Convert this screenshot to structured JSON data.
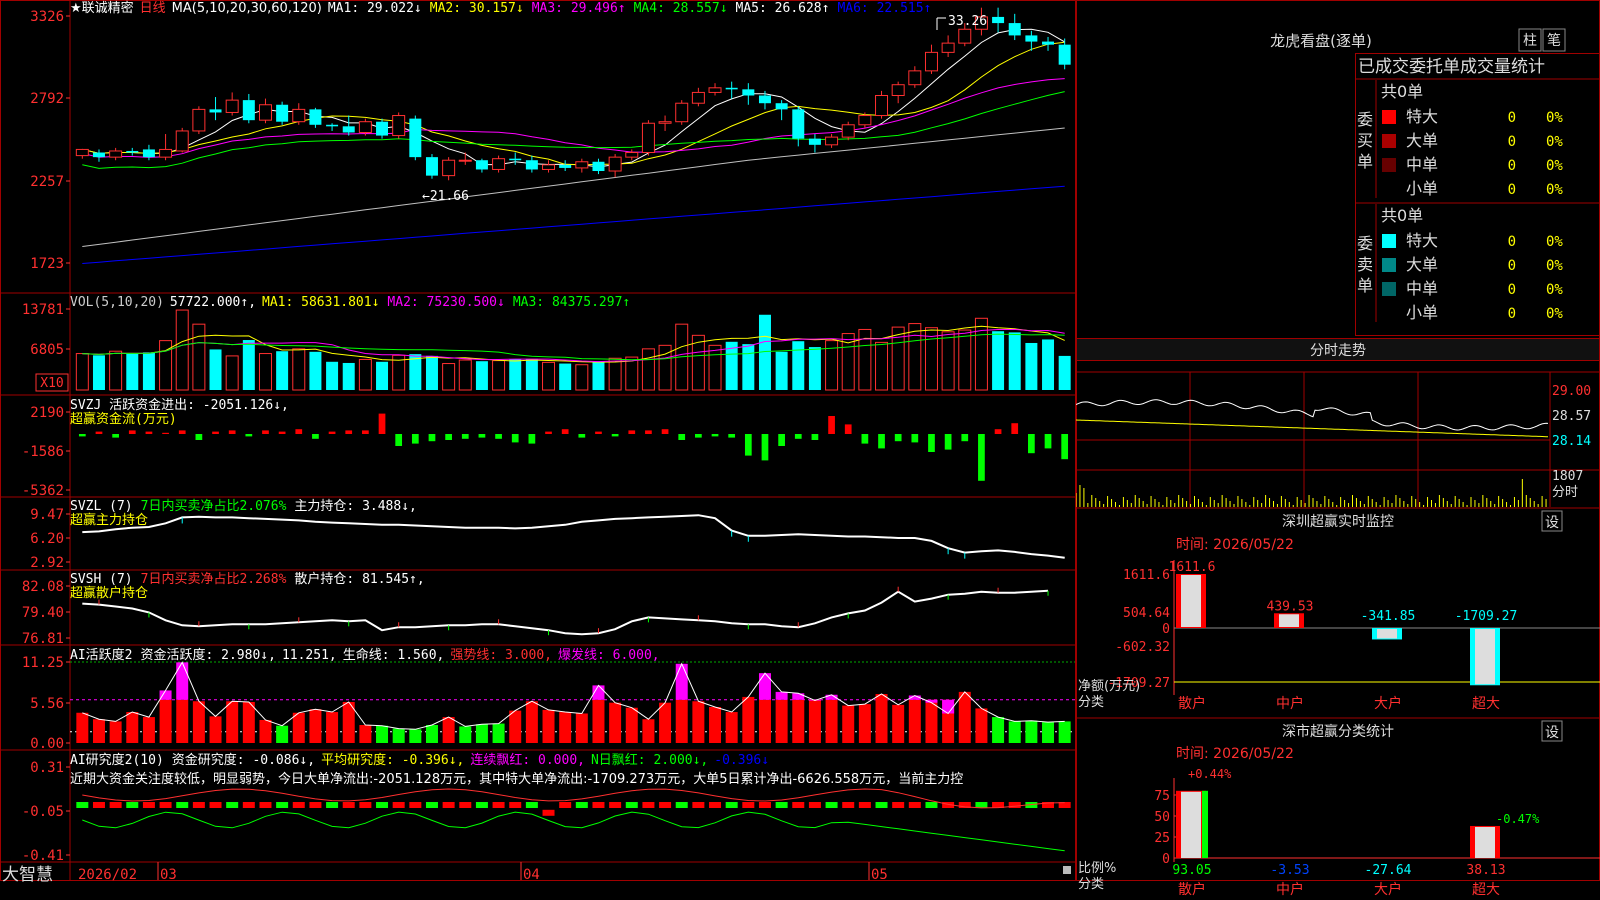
{
  "chart_data": [
    {
      "type": "candlestick",
      "panel": "price",
      "title": "★联诚精密",
      "period": "日线",
      "ma_title": "MA(5,10,20,30,60,120)",
      "ma": [
        {
          "name": "MA1",
          "value": "29.022",
          "arrow": "↓",
          "color": "#ffffff"
        },
        {
          "name": "MA2",
          "value": "30.157",
          "arrow": "↓",
          "color": "#ffff00"
        },
        {
          "name": "MA3",
          "value": "29.496",
          "arrow": "↑",
          "color": "#ff00ff"
        },
        {
          "name": "MA4",
          "value": "28.557",
          "arrow": "↓",
          "color": "#00ff00"
        },
        {
          "name": "MA5",
          "value": "26.628",
          "arrow": "↑",
          "color": "#c0c0c0"
        },
        {
          "name": "MA6",
          "value": "22.515",
          "arrow": "↑",
          "color": "#0000ff"
        }
      ],
      "y_ticks": [
        "3326",
        "2792",
        "2257",
        "1723"
      ],
      "annotations": [
        {
          "text": "33.26"
        },
        {
          "text": "←21.66"
        }
      ],
      "candles": [
        [
          24.2,
          24.6,
          24.0,
          24.4
        ],
        [
          24.4,
          24.1,
          23.8,
          24.6
        ],
        [
          24.1,
          24.5,
          23.9,
          24.7
        ],
        [
          24.5,
          24.4,
          24.2,
          24.7
        ],
        [
          24.6,
          24.1,
          23.9,
          24.9
        ],
        [
          24.1,
          24.6,
          23.9,
          25.6
        ],
        [
          24.5,
          25.8,
          24.4,
          26.0
        ],
        [
          25.8,
          27.2,
          25.6,
          27.4
        ],
        [
          27.2,
          27.0,
          26.5,
          28.0
        ],
        [
          27.0,
          27.8,
          26.8,
          28.3
        ],
        [
          27.8,
          26.5,
          26.3,
          28.2
        ],
        [
          26.5,
          27.5,
          26.3,
          27.9
        ],
        [
          27.5,
          26.4,
          26.2,
          27.7
        ],
        [
          26.4,
          27.2,
          26.2,
          27.6
        ],
        [
          27.2,
          26.2,
          26.0,
          27.3
        ],
        [
          26.2,
          26.1,
          25.8,
          26.3
        ],
        [
          26.1,
          25.7,
          25.5,
          26.8
        ],
        [
          25.7,
          26.4,
          25.5,
          26.6
        ],
        [
          26.4,
          25.5,
          25.3,
          26.6
        ],
        [
          25.5,
          26.8,
          25.3,
          27.0
        ],
        [
          26.6,
          24.1,
          23.9,
          26.8
        ],
        [
          24.1,
          22.9,
          22.7,
          24.3
        ],
        [
          22.9,
          23.9,
          22.6,
          24.1
        ],
        [
          23.9,
          23.9,
          23.6,
          24.4
        ],
        [
          23.9,
          23.3,
          23.1,
          24.0
        ],
        [
          23.3,
          24.0,
          23.1,
          24.2
        ],
        [
          24.0,
          23.9,
          23.6,
          24.4
        ],
        [
          23.9,
          23.3,
          23.1,
          24.2
        ],
        [
          23.3,
          23.6,
          23.1,
          23.9
        ],
        [
          23.6,
          23.4,
          23.2,
          23.9
        ],
        [
          23.4,
          23.8,
          23.1,
          24.0
        ],
        [
          23.8,
          23.2,
          23.0,
          24.0
        ],
        [
          23.2,
          24.1,
          22.8,
          24.3
        ],
        [
          24.1,
          24.4,
          23.9,
          24.6
        ],
        [
          24.4,
          26.3,
          24.2,
          26.5
        ],
        [
          26.3,
          26.4,
          25.8,
          26.8
        ],
        [
          26.4,
          27.6,
          26.2,
          27.8
        ],
        [
          27.6,
          28.3,
          27.4,
          28.6
        ],
        [
          28.3,
          28.6,
          28.1,
          28.9
        ],
        [
          28.6,
          28.5,
          27.9,
          29.0
        ],
        [
          28.5,
          28.1,
          27.5,
          28.9
        ],
        [
          28.1,
          27.6,
          27.2,
          28.4
        ],
        [
          27.6,
          27.2,
          26.5,
          27.8
        ],
        [
          27.2,
          25.3,
          24.8,
          27.4
        ],
        [
          25.3,
          24.9,
          24.4,
          25.6
        ],
        [
          24.9,
          25.4,
          24.7,
          25.6
        ],
        [
          25.4,
          26.2,
          25.2,
          26.4
        ],
        [
          26.2,
          26.8,
          26.0,
          27.0
        ],
        [
          26.8,
          28.1,
          26.6,
          28.4
        ],
        [
          28.1,
          28.8,
          27.6,
          29.0
        ],
        [
          28.8,
          29.7,
          28.6,
          30.0
        ],
        [
          29.7,
          30.9,
          29.5,
          31.4
        ],
        [
          30.9,
          31.5,
          30.6,
          32.0
        ],
        [
          31.5,
          32.4,
          31.3,
          32.8
        ],
        [
          32.4,
          33.2,
          32.0,
          33.8
        ],
        [
          33.2,
          32.8,
          32.2,
          33.8
        ],
        [
          32.8,
          32.0,
          31.7,
          33.4
        ],
        [
          32.0,
          31.6,
          31.0,
          32.3
        ],
        [
          31.6,
          31.4,
          31.0,
          31.9
        ],
        [
          31.4,
          30.1,
          29.8,
          31.8
        ]
      ]
    },
    {
      "type": "bar",
      "panel": "volume",
      "title": "VOL(5,10,20)",
      "value": "57722.000",
      "ma": [
        {
          "name": "MA1",
          "value": "58631.801",
          "arrow": "↓",
          "color": "#ffff00"
        },
        {
          "name": "MA2",
          "value": "75230.500",
          "arrow": "↓",
          "color": "#ff00ff"
        },
        {
          "name": "MA3",
          "value": "84375.297",
          "arrow": "↑",
          "color": "#00ff00"
        }
      ],
      "y_ticks": [
        "13781",
        "6805"
      ],
      "unit": "X10",
      "values": [
        6.2,
        5.9,
        6.6,
        6.2,
        6.4,
        8.4,
        13.6,
        11.2,
        6.9,
        5.8,
        8.5,
        6.2,
        6.6,
        7.0,
        6.5,
        4.8,
        4.6,
        5.2,
        4.8,
        5.9,
        6.1,
        5.8,
        4.5,
        5.1,
        4.9,
        5.0,
        5.2,
        5.3,
        4.7,
        4.5,
        4.3,
        4.9,
        5.4,
        5.6,
        7.0,
        7.6,
        11.2,
        9.3,
        7.6,
        8.2,
        7.8,
        12.8,
        6.5,
        8.3,
        7.3,
        8.4,
        9.6,
        10.3,
        8.1,
        10.7,
        11.3,
        10.6,
        9.9,
        10.2,
        12.2,
        10.0,
        9.8,
        8.0,
        8.6,
        5.8
      ]
    },
    {
      "type": "bar",
      "panel": "svzj",
      "title": "SVZJ",
      "label": "活跃资金进出:",
      "value": "-2051.126",
      "arrow": "↓,",
      "subtitle": "超赢资金流(万元)",
      "y_ticks": [
        "2190",
        "-1586",
        "-5362"
      ],
      "values": [
        -0.2,
        0.2,
        -0.3,
        0.3,
        0.2,
        0.1,
        0.3,
        -0.5,
        0.2,
        0.3,
        -0.2,
        0.3,
        0.2,
        0.4,
        -0.4,
        0.2,
        0.3,
        0.3,
        1.7,
        -1.0,
        -0.8,
        -0.6,
        -0.5,
        -0.4,
        -0.3,
        -0.4,
        -0.7,
        -0.8,
        0.2,
        0.4,
        -0.3,
        0.2,
        -0.2,
        0.3,
        0.3,
        0.4,
        -0.5,
        -0.3,
        -0.2,
        -0.3,
        -1.8,
        -2.2,
        -1.0,
        -0.4,
        -0.5,
        1.5,
        0.8,
        -0.8,
        -1.2,
        -0.6,
        -0.7,
        -1.5,
        -1.3,
        -0.6,
        -3.9,
        0.4,
        0.9,
        -1.6,
        -1.2,
        -2.1
      ]
    },
    {
      "type": "line",
      "panel": "svzl",
      "title": "SVZL (7)",
      "label": "7日内买卖净占比2.076%",
      "main_label": "主力持仓:",
      "value": "3.488",
      "arrow": "↓,",
      "subtitle": "超赢主力持仓",
      "y_ticks": [
        "9.47",
        "6.20",
        "2.92"
      ],
      "values": [
        7.0,
        7.1,
        7.4,
        7.6,
        7.7,
        8.2,
        9.0,
        9.1,
        9.0,
        9.0,
        8.9,
        8.8,
        8.7,
        8.6,
        8.4,
        8.3,
        8.2,
        8.1,
        8.0,
        8.0,
        7.9,
        7.8,
        7.7,
        7.6,
        7.6,
        7.6,
        7.5,
        7.6,
        7.8,
        8.0,
        8.4,
        8.6,
        8.8,
        8.9,
        9.0,
        9.1,
        9.2,
        9.3,
        8.9,
        7.2,
        6.5,
        6.5,
        6.6,
        6.7,
        6.6,
        6.5,
        6.4,
        6.4,
        6.3,
        6.2,
        6.2,
        5.8,
        4.8,
        4.2,
        4.4,
        4.5,
        4.3,
        4.0,
        3.8,
        3.5
      ]
    },
    {
      "type": "line",
      "panel": "svsh",
      "title": "SVSH (7)",
      "label": "7日内买卖净占比2.268%",
      "main_label": "散户持仓:",
      "value": "81.545",
      "arrow": "↑,",
      "subtitle": "超赢散户持仓",
      "y_ticks": [
        "82.08",
        "79.40",
        "76.81"
      ],
      "values": [
        80.3,
        80.2,
        80.0,
        79.8,
        79.4,
        78.6,
        78.1,
        78.0,
        78.1,
        78.2,
        78.2,
        78.2,
        78.3,
        78.4,
        78.5,
        78.6,
        78.5,
        78.6,
        77.6,
        77.9,
        77.9,
        78.0,
        78.1,
        78.1,
        78.2,
        78.2,
        78.0,
        77.8,
        77.6,
        77.3,
        77.2,
        77.3,
        77.7,
        78.5,
        78.9,
        78.8,
        78.7,
        78.6,
        78.5,
        78.3,
        78.2,
        78.2,
        78.0,
        77.9,
        78.3,
        78.9,
        79.3,
        79.6,
        80.4,
        81.5,
        80.5,
        80.8,
        81.2,
        81.3,
        81.5,
        81.4,
        81.4,
        81.5,
        81.6
      ]
    },
    {
      "type": "bar",
      "panel": "ai_active",
      "title": "AI活跃度2",
      "labels": [
        {
          "text": "资金活跃度: 2.980",
          "arrow": "↓,",
          "color": "#ffffff"
        },
        {
          "text": "11.251",
          "arrow": ",",
          "color": "#ffffff"
        },
        {
          "text": "生命线: 1.560",
          "arrow": ",",
          "color": "#ffffff"
        },
        {
          "text": "强势线: 3.000",
          "arrow": ",",
          "color": "#ff3030"
        },
        {
          "text": "爆发线: 6.000",
          "arrow": ",",
          "color": "#ff00ff"
        }
      ],
      "y_ticks": [
        "11.25",
        "5.56",
        "0.00"
      ],
      "values": [
        4.2,
        3.3,
        3.0,
        4.3,
        3.6,
        7.3,
        11.2,
        5.8,
        3.7,
        5.8,
        5.7,
        3.2,
        2.4,
        4.2,
        4.7,
        4.3,
        5.7,
        2.5,
        2.4,
        2.0,
        1.9,
        2.5,
        3.6,
        2.3,
        2.6,
        2.7,
        4.5,
        5.8,
        4.6,
        4.3,
        4.1,
        8.0,
        5.6,
        4.9,
        3.3,
        5.6,
        11.0,
        5.8,
        5.0,
        4.3,
        6.4,
        9.7,
        7.1,
        6.9,
        5.9,
        6.7,
        5.2,
        5.4,
        6.8,
        5.3,
        6.6,
        5.6,
        4.1,
        7.1,
        4.8,
        3.6,
        3.0,
        3.1,
        2.9,
        3.0
      ],
      "colors": [
        "r",
        "r",
        "r",
        "r",
        "r",
        "m",
        "m",
        "r",
        "r",
        "r",
        "r",
        "r",
        "g",
        "r",
        "r",
        "r",
        "r",
        "r",
        "g",
        "g",
        "g",
        "g",
        "r",
        "g",
        "g",
        "g",
        "r",
        "r",
        "r",
        "r",
        "r",
        "m",
        "r",
        "r",
        "r",
        "r",
        "m",
        "r",
        "r",
        "r",
        "r",
        "m",
        "m",
        "m",
        "m",
        "m",
        "r",
        "r",
        "r",
        "r",
        "m",
        "m",
        "m",
        "r",
        "r",
        "g",
        "g",
        "g",
        "g",
        "g"
      ]
    },
    {
      "type": "bar",
      "panel": "ai_research",
      "title": "AI研究度2(10)",
      "labels": [
        {
          "text": "资金研究度: -0.086",
          "arrow": "↓,",
          "color": "#ffffff"
        },
        {
          "text": "平均研究度: -0.396",
          "arrow": "↓,",
          "color": "#ffff00"
        },
        {
          "text": "连续飘红: 0.000",
          "arrow": ",",
          "color": "#ff00ff"
        },
        {
          "text": "N日飘红: 2.000",
          "arrow": "↓,",
          "color": "#00ff00"
        },
        {
          "text": "-0.396",
          "arrow": "↓",
          "color": "#0000ff"
        }
      ],
      "y_ticks": [
        "0.31",
        "-0.05",
        "-0.41"
      ],
      "commentary": "近期大资金关注度较低，明显弱势，今日大单净流出:-2051.128万元，其中特大单净流出:-1709.273万元，大单5日累计净出-6626.558万元，当前主力控",
      "values": [
        -0.06,
        -0.03,
        -0.02,
        -0.01,
        -0.03,
        -0.02,
        -0.03,
        -0.02,
        -0.03,
        -0.02,
        -0.06,
        -0.01,
        -0.06,
        -0.03,
        -0.05,
        -0.04,
        -0.09,
        -0.03,
        -0.04,
        -0.02,
        -0.06,
        -0.09,
        -0.03,
        -0.03,
        -0.05,
        -0.07,
        -0.03,
        -0.02,
        0.01,
        -0.03,
        -0.02,
        -0.01,
        -0.03,
        -0.02,
        -0.06,
        -0.02,
        -0.03,
        -0.04,
        -0.07,
        -0.01,
        -0.03,
        -0.02,
        -0.04,
        -0.03,
        -0.03,
        -0.02,
        -0.02,
        -0.06,
        -0.03,
        -0.04,
        -0.06,
        -0.03,
        -0.07,
        -0.09,
        -0.11,
        -0.08,
        -0.06,
        -0.09,
        -0.08,
        -0.06
      ],
      "x_labels": [
        "2026/02",
        "03",
        "04",
        "05"
      ]
    }
  ],
  "brand": "大智慧",
  "side": {
    "lhb": {
      "title": "龙虎看盘(逐单)",
      "buttons": [
        "柱",
        "笔"
      ],
      "tabs": [
        "已成交委托单成交量统计"
      ],
      "buy": {
        "label": "委买单",
        "count": "共0单",
        "rows": [
          {
            "name": "特大",
            "count": "0",
            "pct": "0%",
            "color": "#ff0000"
          },
          {
            "name": "大单",
            "count": "0",
            "pct": "0%",
            "color": "#aa0000"
          },
          {
            "name": "中单",
            "count": "0",
            "pct": "0%",
            "color": "#660000"
          },
          {
            "name": "小单",
            "count": "0",
            "pct": "0%",
            "color": ""
          }
        ]
      },
      "sell": {
        "label": "委卖单",
        "count": "共0单",
        "rows": [
          {
            "name": "特大",
            "count": "0",
            "pct": "0%",
            "color": "#00ffff"
          },
          {
            "name": "大单",
            "count": "0",
            "pct": "0%",
            "color": "#008888"
          },
          {
            "name": "中单",
            "count": "0",
            "pct": "0%",
            "color": "#006666"
          },
          {
            "name": "小单",
            "count": "0",
            "pct": "0%",
            "color": ""
          }
        ]
      }
    },
    "intraday": {
      "title": "分时走势",
      "y_ticks": [
        "29.00",
        "28.57",
        "28.14"
      ],
      "vol_tick": "1807",
      "vol_label": "分时"
    },
    "sz_monitor": {
      "title": "深圳超赢实时监控",
      "set": "设",
      "time": "时间: 2026/05/22",
      "y_ticks": [
        "1611.6",
        "504.64",
        "0",
        "-602.32",
        "-1709.27"
      ],
      "ylabel": [
        "净额(万元)",
        "分类"
      ],
      "categories": [
        "散户",
        "中户",
        "大户",
        "超大"
      ],
      "values": [
        1611.6,
        439.53,
        -341.85,
        -1709.27
      ],
      "value_labels": [
        "1611.6",
        "439.53",
        "-341.85",
        "-1709.27"
      ]
    },
    "sz_class": {
      "title": "深市超赢分类统计",
      "set": "设",
      "time": "时间: 2026/05/22",
      "y_ticks": [
        "75",
        "50",
        "25",
        "0"
      ],
      "ylabel": [
        "比例%",
        "分类"
      ],
      "categories": [
        "散户",
        "中户",
        "大户",
        "超大"
      ],
      "values": [
        93.05,
        -3.53,
        -27.64,
        38.13
      ],
      "value_labels": [
        "93.05",
        "-3.53",
        "-27.64",
        "38.13"
      ],
      "top_labels": [
        "+0.44%",
        "",
        "",
        "-0.47%"
      ]
    }
  }
}
